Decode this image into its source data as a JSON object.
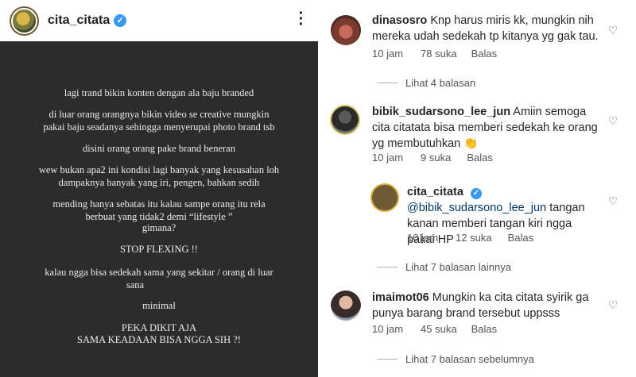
{
  "post": {
    "username": "cita_citata",
    "image_lines": [
      "lagi trand bikin konten dengan ala baju branded",
      "di luar orang orangnya bikin video se creative mungkin",
      "pakai baju seadanya sehingga menyerupai photo brand tsb",
      "disini orang orang pake brand beneran",
      "wew bukan apa2 ini kondisi lagi banyak yang kesusahan loh",
      "dampaknya banyak yang iri, pengen, bahkan sedih",
      "mending hanya sebatas itu kalau sampe orang itu rela",
      "berbuat yang tidak2 demi “lifestyle ”",
      "gimana?",
      "STOP FLEXING !!",
      "kalau ngga bisa sedekah sama yang sekitar / orang di luar",
      "sana",
      "minimal",
      "PEKA DIKIT AJA",
      "SAMA KEADAAN BISA NGGA SIH ?!"
    ]
  },
  "comments": [
    {
      "username": "dinasosro",
      "text": "Knp harus miris kk, mungkin nih mereka udah sedekah tp kitanya yg gak tau.",
      "time": "10 jam",
      "likes": "78 suka",
      "reply": "Balas",
      "view_replies": "Lihat 4 balasan"
    },
    {
      "username": "bibik_sudarsono_lee_jun",
      "text": "Amiin semoga cita citatata bisa memberi sedekah ke orang yg membutuhkan 👏",
      "time": "10 jam",
      "likes": "9 suka",
      "reply": "Balas"
    },
    {
      "username": "cita_citata",
      "mention": "@bibik_sudarsono_lee_jun",
      "text": "tangan kanan memberi tangan kiri ngga pakai HP",
      "time": "10 jam",
      "likes": "12 suka",
      "reply": "Balas",
      "view_replies": "Lihat 7 balasan lainnya"
    },
    {
      "username": "imaimot06",
      "text": "Mungkin ka cita citata syirik ga punya barang brand  tersebut uppsss",
      "time": "10 jam",
      "likes": "45 suka",
      "reply": "Balas",
      "view_replies": "Lihat 7 balasan sebelumnya"
    }
  ],
  "icons": {
    "verified": "verified-badge",
    "more": "more-options",
    "like": "heart-outline"
  }
}
